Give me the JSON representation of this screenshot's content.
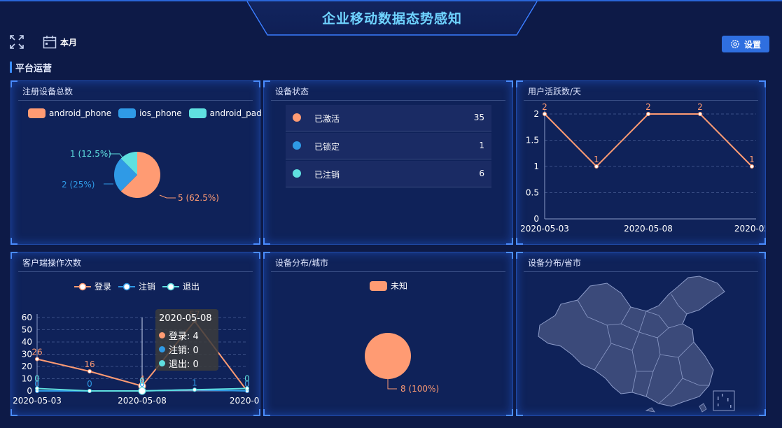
{
  "header": {
    "title": "企业移动数据态势感知"
  },
  "toolbar": {
    "period_label": "本月",
    "settings_label": "设置"
  },
  "section": {
    "title": "平台运营"
  },
  "colors": {
    "orange": "#ff9b73",
    "blue": "#2f9ae6",
    "cyan": "#5fe0e0",
    "accent": "#2f6fe0"
  },
  "panels": {
    "registered": {
      "title": "注册设备总数",
      "legend": [
        "android_phone",
        "ios_phone",
        "android_pad"
      ],
      "labels": [
        "5 (62.5%)",
        "2 (25%)",
        "1 (12.5%)"
      ]
    },
    "status": {
      "title": "设备状态",
      "rows": [
        {
          "label": "已激活",
          "count": "35"
        },
        {
          "label": "已锁定",
          "count": "1"
        },
        {
          "label": "已注销",
          "count": "6"
        }
      ]
    },
    "active_users": {
      "title": "用户活跃数/天"
    },
    "operations": {
      "title": "客户端操作次数",
      "legend": [
        "登录",
        "注销",
        "退出"
      ]
    },
    "city": {
      "title": "设备分布/城市",
      "legend": [
        "未知"
      ],
      "label": "8 (100%)"
    },
    "province": {
      "title": "设备分布/省市"
    }
  },
  "tooltip": {
    "title": "2020-05-08",
    "rows": [
      "登录: 4",
      "注销: 0",
      "退出: 0"
    ]
  },
  "chart_data": [
    {
      "type": "pie",
      "title": "注册设备总数",
      "categories": [
        "android_phone",
        "ios_phone",
        "android_pad"
      ],
      "values": [
        5,
        2,
        1
      ]
    },
    {
      "type": "line",
      "title": "用户活跃数/天",
      "x": [
        "2020-05-03",
        "",
        "2020-05-08",
        "",
        "2020-05"
      ],
      "values": [
        2,
        1,
        2,
        2,
        1
      ],
      "point_labels": [
        "2",
        "1",
        "2",
        "2",
        "1"
      ],
      "yticks": [
        "0",
        "0.5",
        "1",
        "1.5",
        "2"
      ],
      "ylim": [
        0,
        2
      ],
      "grid": true
    },
    {
      "type": "line",
      "title": "客户端操作次数",
      "x": [
        "2020-05-03",
        "",
        "2020-05-08",
        "",
        "2020-05"
      ],
      "series": [
        {
          "name": "登录",
          "values": [
            26,
            16,
            4,
            57,
            0
          ],
          "labels": [
            "26",
            "16",
            "4",
            "57",
            "0"
          ]
        },
        {
          "name": "注销",
          "values": [
            0,
            0,
            0,
            1,
            0
          ],
          "labels": [
            "0",
            "0",
            "0",
            "1",
            "0"
          ]
        },
        {
          "name": "退出",
          "values": [
            2,
            0,
            0,
            1,
            2
          ],
          "labels": [
            "0",
            "",
            "0",
            "",
            "0"
          ]
        }
      ],
      "yticks": [
        "0",
        "10",
        "20",
        "30",
        "40",
        "50",
        "60"
      ],
      "ylim": [
        0,
        60
      ],
      "grid": true
    },
    {
      "type": "pie",
      "title": "设备分布/城市",
      "categories": [
        "未知"
      ],
      "values": [
        8
      ]
    }
  ]
}
